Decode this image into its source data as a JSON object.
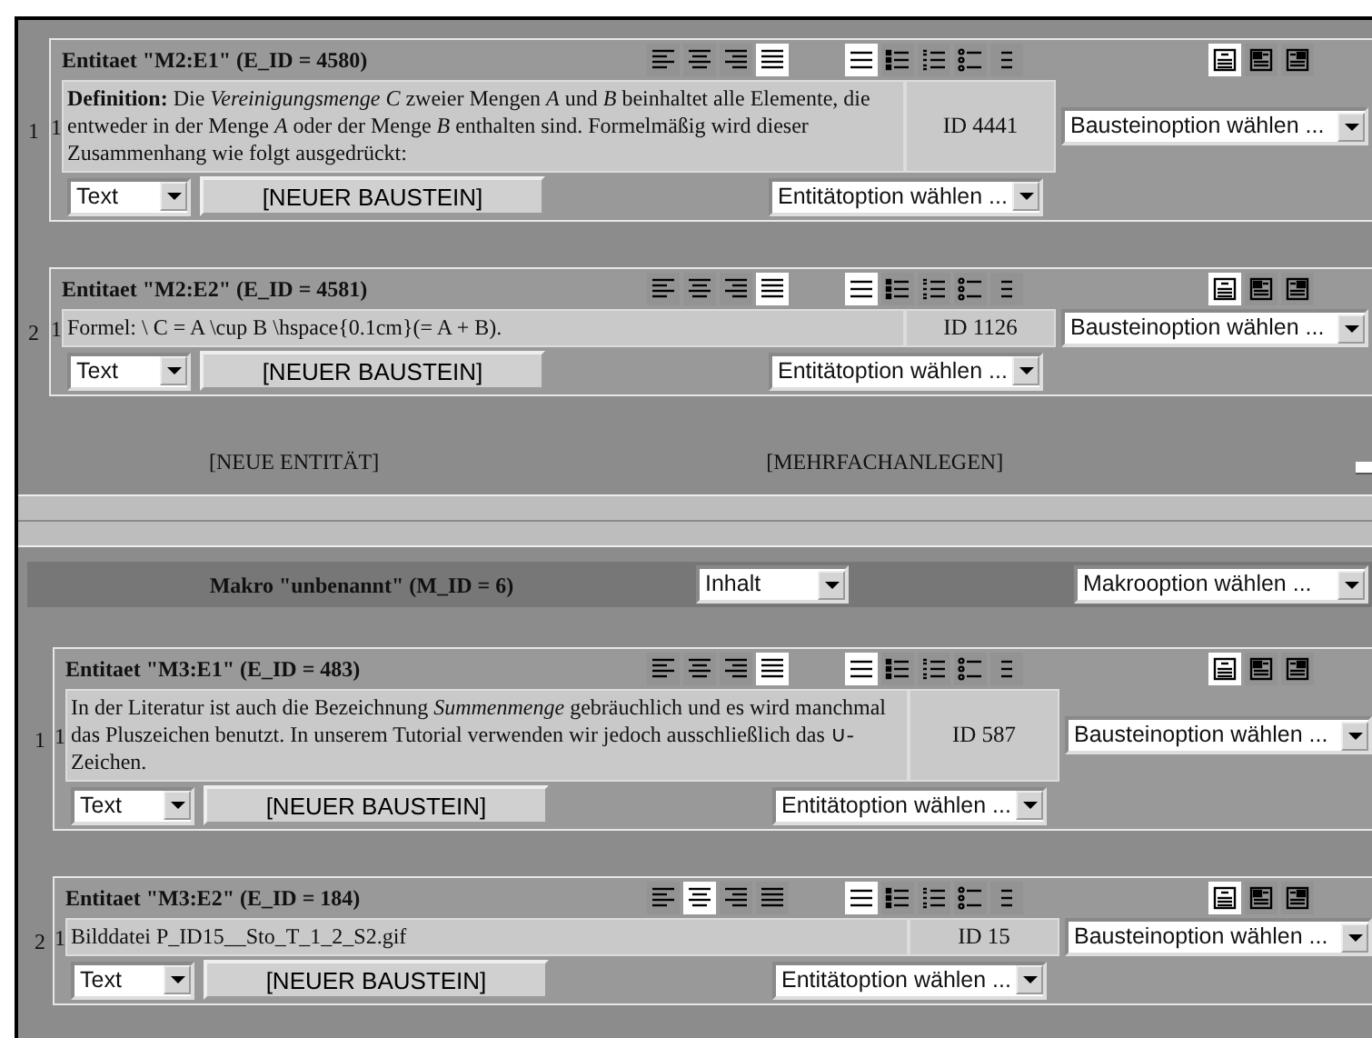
{
  "module_entities": [
    {
      "number": "1",
      "title": "Entitaet \"M2:E1\" (E_ID = 4580)",
      "align": [
        {
          "kind": "left",
          "selected": false
        },
        {
          "kind": "center",
          "selected": false
        },
        {
          "kind": "right",
          "selected": false
        },
        {
          "kind": "justify",
          "selected": true
        }
      ],
      "lists": [
        {
          "kind": "plain",
          "selected": true
        },
        {
          "kind": "bullet",
          "selected": false
        },
        {
          "kind": "number",
          "selected": false
        },
        {
          "kind": "alpha",
          "selected": false
        },
        {
          "kind": "indent",
          "selected": false
        }
      ],
      "layouts": [
        {
          "kind": "top",
          "selected": true
        },
        {
          "kind": "left",
          "selected": false
        },
        {
          "kind": "right",
          "selected": false
        }
      ],
      "blocks": [
        {
          "number": "1",
          "text": "**Definition:** Die *Vereinigungsmenge C* zweier Mengen *A* und *B* beinhaltet alle Elemente, die entweder in der Menge *A* oder der Menge *B* enthalten sind. Formelmäßig wird dieser Zusammenhang wie folgt ausgedrückt:",
          "id": "ID 4441",
          "option": "Bausteinoption wählen ..."
        }
      ],
      "type_select": "Text",
      "new_block": "[NEUER BAUSTEIN]",
      "entity_option": "Entitätoption wählen ..."
    },
    {
      "number": "2",
      "title": "Entitaet \"M2:E2\" (E_ID = 4581)",
      "align": [
        {
          "kind": "left",
          "selected": false
        },
        {
          "kind": "center",
          "selected": false
        },
        {
          "kind": "right",
          "selected": false
        },
        {
          "kind": "justify",
          "selected": true
        }
      ],
      "lists": [
        {
          "kind": "plain",
          "selected": true
        },
        {
          "kind": "bullet",
          "selected": false
        },
        {
          "kind": "number",
          "selected": false
        },
        {
          "kind": "alpha",
          "selected": false
        },
        {
          "kind": "indent",
          "selected": false
        }
      ],
      "layouts": [
        {
          "kind": "top",
          "selected": true
        },
        {
          "kind": "left",
          "selected": false
        },
        {
          "kind": "right",
          "selected": false
        }
      ],
      "blocks": [
        {
          "number": "1",
          "text": "Formel: \\ C = A \\cup B \\hspace{0.1cm}(= A + B).",
          "id": "ID 1126",
          "option": "Bausteinoption wählen ..."
        }
      ],
      "type_select": "Text",
      "new_block": "[NEUER BAUSTEIN]",
      "entity_option": "Entitätoption wählen ..."
    }
  ],
  "module_actions": {
    "new_entity": "[NEUE ENTITÄT]",
    "multi_create": "[MEHRFACHANLEGEN]"
  },
  "macro": {
    "title": "Makro \"unbenannt\" (M_ID = 6)",
    "content_select": "Inhalt",
    "option_select": "Makrooption wählen ..."
  },
  "macro_entities": [
    {
      "number": "1",
      "title": "Entitaet \"M3:E1\" (E_ID = 483)",
      "align": [
        {
          "kind": "left",
          "selected": false
        },
        {
          "kind": "center",
          "selected": false
        },
        {
          "kind": "right",
          "selected": false
        },
        {
          "kind": "justify",
          "selected": true
        }
      ],
      "lists": [
        {
          "kind": "plain",
          "selected": true
        },
        {
          "kind": "bullet",
          "selected": false
        },
        {
          "kind": "number",
          "selected": false
        },
        {
          "kind": "alpha",
          "selected": false
        },
        {
          "kind": "indent",
          "selected": false
        }
      ],
      "layouts": [
        {
          "kind": "top",
          "selected": true
        },
        {
          "kind": "left",
          "selected": false
        },
        {
          "kind": "right",
          "selected": false
        }
      ],
      "blocks": [
        {
          "number": "1",
          "text": "In der Literatur ist auch die Bezeichnung *Summenmenge* gebräuchlich und es wird manchmal das Pluszeichen benutzt. In unserem Tutorial verwenden wir jedoch ausschließlich das ∪-Zeichen.",
          "id": "ID 587",
          "option": "Bausteinoption wählen ..."
        }
      ],
      "type_select": "Text",
      "new_block": "[NEUER BAUSTEIN]",
      "entity_option": "Entitätoption wählen ..."
    },
    {
      "number": "2",
      "title": "Entitaet \"M3:E2\" (E_ID = 184)",
      "align": [
        {
          "kind": "left",
          "selected": false
        },
        {
          "kind": "center",
          "selected": true
        },
        {
          "kind": "right",
          "selected": false
        },
        {
          "kind": "justify",
          "selected": false
        }
      ],
      "lists": [
        {
          "kind": "plain",
          "selected": true
        },
        {
          "kind": "bullet",
          "selected": false
        },
        {
          "kind": "number",
          "selected": false
        },
        {
          "kind": "alpha",
          "selected": false
        },
        {
          "kind": "indent",
          "selected": false
        }
      ],
      "layouts": [
        {
          "kind": "top",
          "selected": true
        },
        {
          "kind": "left",
          "selected": false
        },
        {
          "kind": "right",
          "selected": false
        }
      ],
      "blocks": [
        {
          "number": "1",
          "text": "Bilddatei P_ID15__Sto_T_1_2_S2.gif",
          "id": "ID 15",
          "option": "Bausteinoption wählen ..."
        }
      ],
      "type_select": "Text",
      "new_block": "[NEUER BAUSTEIN]",
      "entity_option": "Entitätoption wählen ..."
    }
  ]
}
